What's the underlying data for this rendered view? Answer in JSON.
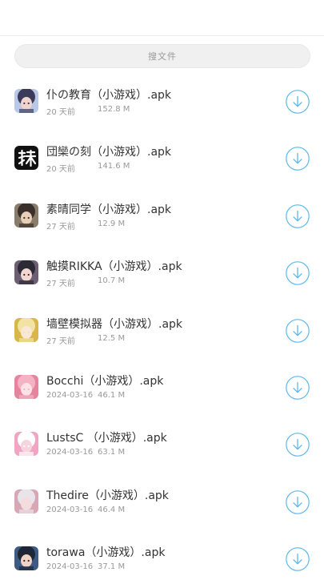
{
  "search": {
    "placeholder": "搜文件"
  },
  "accent_color": "#5bb8ec",
  "files": [
    {
      "name": "仆の教育（小游戏）.apk",
      "date": "20 天前",
      "size": "152.8 M",
      "icon": "anime-girl-blue-hair-icon",
      "icon_colors": [
        "#3b3a5a",
        "#b9c8e6",
        "#f2d4cc"
      ]
    },
    {
      "name": "団欒の刻（小游戏）.apk",
      "date": "20 天前",
      "size": "141.6 M",
      "icon": "kanji-logo-icon",
      "icon_colors": [
        "#111111",
        "#ffffff",
        "#333333"
      ]
    },
    {
      "name": "素晴同学（小游戏）.apk",
      "date": "27 天前",
      "size": "12.9 M",
      "icon": "anime-girl-dark-hat-icon",
      "icon_colors": [
        "#3a2f2a",
        "#8a7c6a",
        "#e8cdb7"
      ]
    },
    {
      "name": "触摸RIKKA（小游戏）.apk",
      "date": "27 天前",
      "size": "10.7 M",
      "icon": "anime-girl-black-hair-icon",
      "icon_colors": [
        "#2b2a35",
        "#6c5f74",
        "#f1d7cf"
      ]
    },
    {
      "name": "墙壁模拟器（小游戏）.apk",
      "date": "27 天前",
      "size": "12.5 M",
      "icon": "anime-girl-blonde-icon",
      "icon_colors": [
        "#f2e3a4",
        "#d9b64c",
        "#fbe7d8"
      ]
    },
    {
      "name": "Bocchi（小游戏）.apk",
      "date": "2024-03-16",
      "size": "46.1 M",
      "icon": "anime-girl-pink-hair-icon",
      "icon_colors": [
        "#f3b3c4",
        "#e5849c",
        "#fde3e6"
      ]
    },
    {
      "name": "LustsC （小游戏）.apk",
      "date": "2024-03-16",
      "size": "63.1 M",
      "icon": "anime-bunny-girl-icon",
      "icon_colors": [
        "#ffffff",
        "#f0a6c2",
        "#f6d4dd"
      ]
    },
    {
      "name": "Thedire（小游戏）.apk",
      "date": "2024-03-16",
      "size": "46.4 M",
      "icon": "anime-girl-silver-hair-icon",
      "icon_colors": [
        "#e9e4ea",
        "#d8a6b4",
        "#f5dcdc"
      ]
    },
    {
      "name": "torawa（小游戏）.apk",
      "date": "2024-03-16",
      "size": "37.1 M",
      "icon": "anime-girl-navy-hair-icon",
      "icon_colors": [
        "#1e2737",
        "#3e5b84",
        "#f0d3c4"
      ]
    }
  ]
}
